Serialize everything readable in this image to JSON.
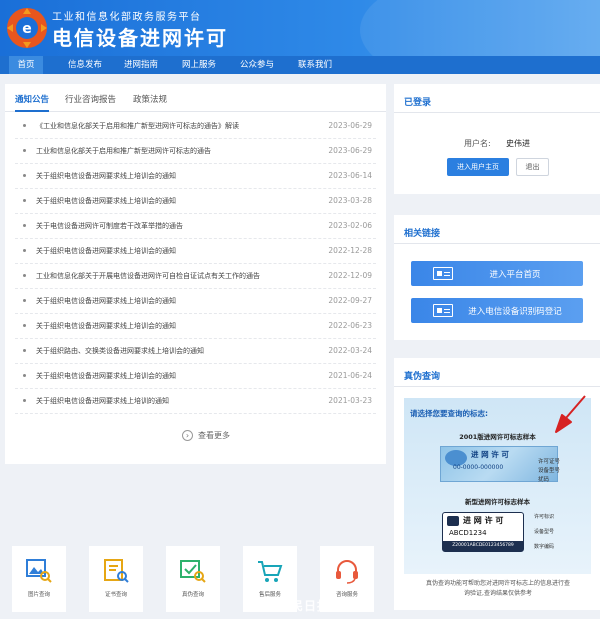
{
  "site": {
    "subtitle": "工业和信息化部政务服务平台",
    "title": "电信设备进网许可"
  },
  "nav": {
    "items": [
      {
        "label": "首页",
        "active": true
      },
      {
        "label": "信息发布"
      },
      {
        "label": "进网指南"
      },
      {
        "label": "网上服务"
      },
      {
        "label": "公众参与"
      },
      {
        "label": "联系我们"
      }
    ]
  },
  "news": {
    "tabs": [
      {
        "label": "通知公告",
        "active": true
      },
      {
        "label": "行业咨询报告"
      },
      {
        "label": "政策法规"
      }
    ],
    "items": [
      {
        "title": "《工业和信息化部关于启用和推广新型进网许可标志的通告》解读",
        "date": "2023-06-29"
      },
      {
        "title": "工业和信息化部关于启用和推广新型进网许可标志的通告",
        "date": "2023-06-29"
      },
      {
        "title": "关于组织电信设备进网要求线上培训会的通知",
        "date": "2023-06-14"
      },
      {
        "title": "关于组织电信设备进网要求线上培训会的通知",
        "date": "2023-03-28"
      },
      {
        "title": "关于电信设备进网许可制度若干改革举措的通告",
        "date": "2023-02-06"
      },
      {
        "title": "关于组织电信设备进网要求线上培训会的通知",
        "date": "2022-12-28"
      },
      {
        "title": "工业和信息化部关于开展电信设备进网许可自检自证试点有关工作的通告",
        "date": "2022-12-09"
      },
      {
        "title": "关于组织电信设备进网要求线上培训会的通知",
        "date": "2022-09-27"
      },
      {
        "title": "关于组织电信设备进网要求线上培训会的通知",
        "date": "2022-06-23"
      },
      {
        "title": "关于组织路由、交换类设备进网要求线上培训会的通知",
        "date": "2022-03-24"
      },
      {
        "title": "关于组织电信设备进网要求线上培训会的通知",
        "date": "2021-06-24"
      },
      {
        "title": "关于组织电信设备进网要求线上培训的通知",
        "date": "2021-03-23"
      }
    ],
    "more_label": "查看更多"
  },
  "login": {
    "title": "已登录",
    "user_label": "用户名:",
    "user_value": "史伟进",
    "enter_button": "进入用户主页",
    "logout_button": "退出"
  },
  "links": {
    "title": "相关链接",
    "items": [
      {
        "label": "进入平台首页"
      },
      {
        "label": "进入电信设备识别码登记"
      }
    ]
  },
  "verify": {
    "title": "真伪查询",
    "prompt": "请选择您要查询的标志:",
    "sample_2001_title": "2001版进网许可标志样本",
    "sample_2001_main": "进 网 许 可",
    "sample_2001_code": "00-0000-000000",
    "sample_2001_label1": "许可证号",
    "sample_2001_label2": "设备型号",
    "sample_2001_label3": "扰码",
    "sample_new_title": "新型进网许可标志样本",
    "sample_new_main": "进 网 许 可",
    "sample_new_code1": "ABCD1234",
    "sample_new_code2": "Z20001ABCDE0123456789",
    "sample_new_label1": "许可标识",
    "sample_new_label2": "设备型号",
    "sample_new_label3": "数字编码",
    "note_line1": "真伪查询功能可帮助您对进网许可标志上的信息进行查",
    "note_line2": "询验证,查询结果仅供参考"
  },
  "services": [
    {
      "label": "图片查询",
      "color": "#2f7ed8"
    },
    {
      "label": "证书查询",
      "color": "#e6a614"
    },
    {
      "label": "真伪查询",
      "color": "#2db16b"
    },
    {
      "label": "售后服务",
      "color": "#18a5b8"
    },
    {
      "label": "咨询服务",
      "color": "#e8593c"
    }
  ],
  "watermark": "人民日报",
  "colors": {
    "primary": "#1e6fcf",
    "accent_arrow": "#d62222"
  }
}
